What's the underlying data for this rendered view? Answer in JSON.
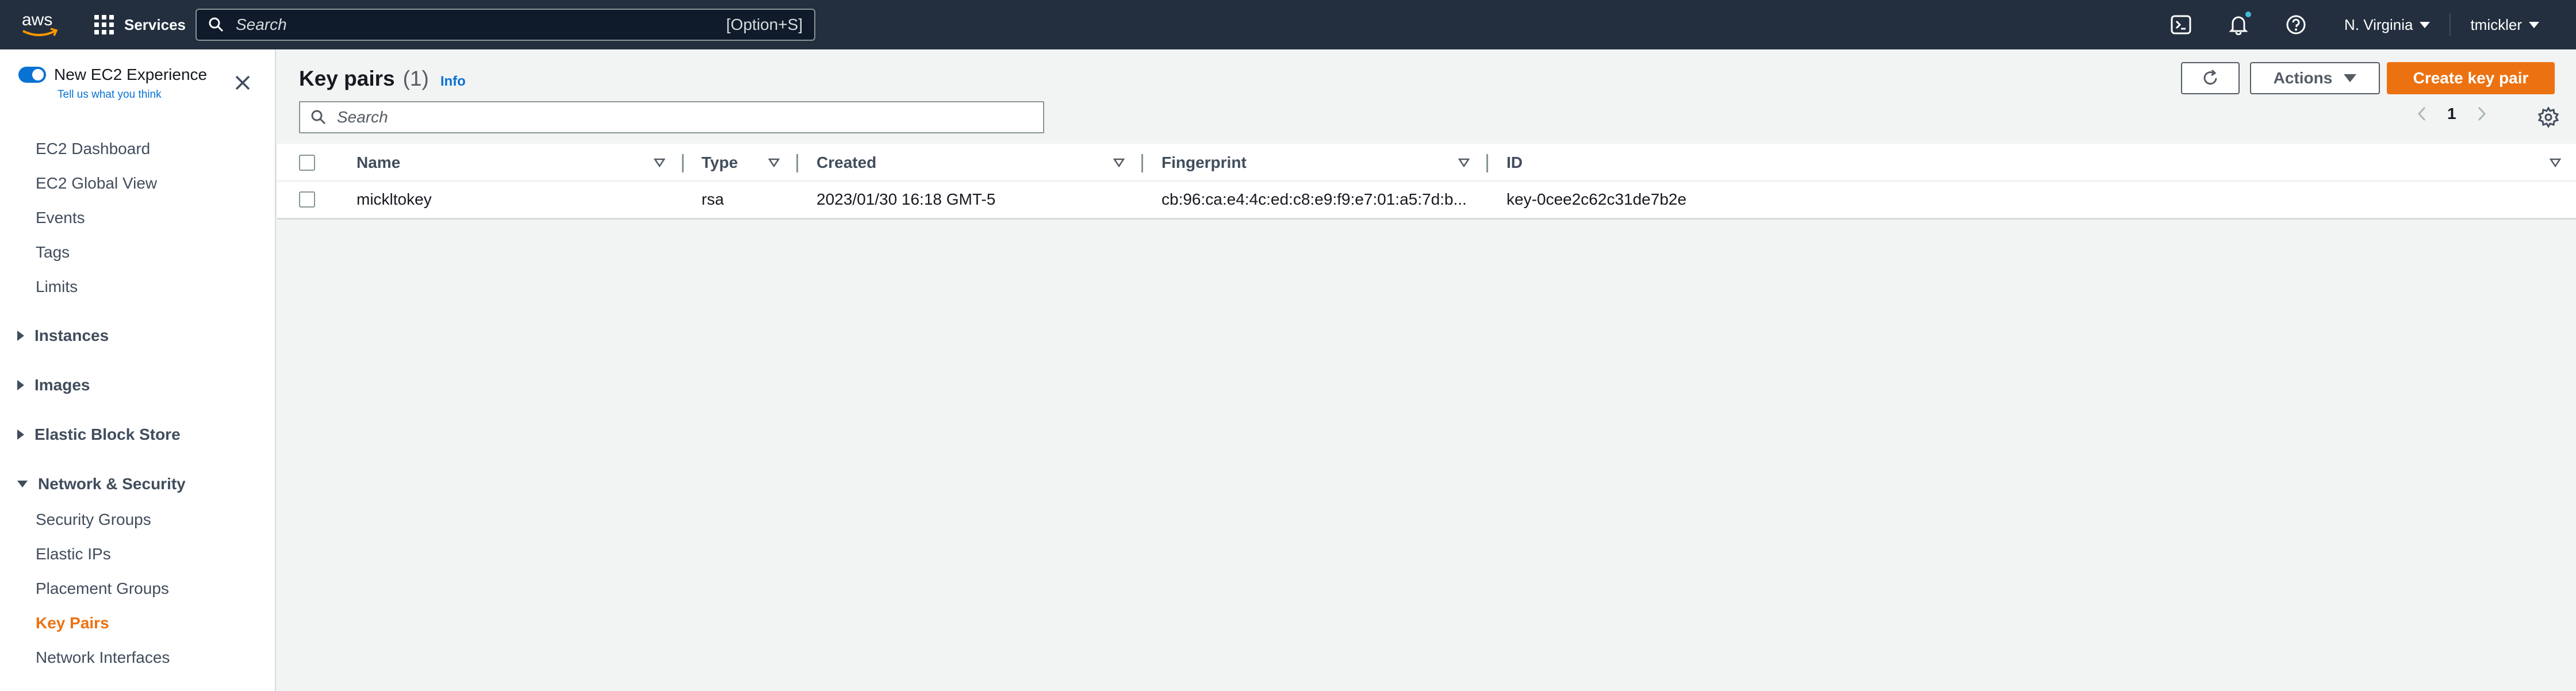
{
  "topnav": {
    "logo_text": "aws",
    "services_label": "Services",
    "search_placeholder": "Search",
    "search_shortcut": "[Option+S]",
    "region": "N. Virginia",
    "user": "tmickler"
  },
  "sidebar": {
    "toggle_label": "New EC2 Experience",
    "tell_us": "Tell us what you think",
    "links_top": [
      "EC2 Dashboard",
      "EC2 Global View",
      "Events",
      "Tags",
      "Limits"
    ],
    "sections": [
      "Instances",
      "Images",
      "Elastic Block Store",
      "Network & Security"
    ],
    "network_links": [
      "Security Groups",
      "Elastic IPs",
      "Placement Groups",
      "Key Pairs",
      "Network Interfaces"
    ],
    "active_link": "Key Pairs"
  },
  "main": {
    "title": "Key pairs",
    "count": "(1)",
    "info": "Info",
    "actions_label": "Actions",
    "create_label": "Create key pair",
    "search_placeholder": "Search",
    "page_number": "1",
    "columns": [
      "Name",
      "Type",
      "Created",
      "Fingerprint",
      "ID"
    ],
    "rows": [
      {
        "name": "mickltokey",
        "type": "rsa",
        "created": "2023/01/30 16:18 GMT-5",
        "fingerprint": "cb:96:ca:e4:4c:ed:c8:e9:f9:e7:01:a5:7d:b...",
        "id": "key-0cee2c62c31de7b2e"
      }
    ]
  },
  "colors": {
    "nav_bg": "#232f3e",
    "accent_orange": "#ec7211",
    "link_blue": "#0972d3"
  }
}
